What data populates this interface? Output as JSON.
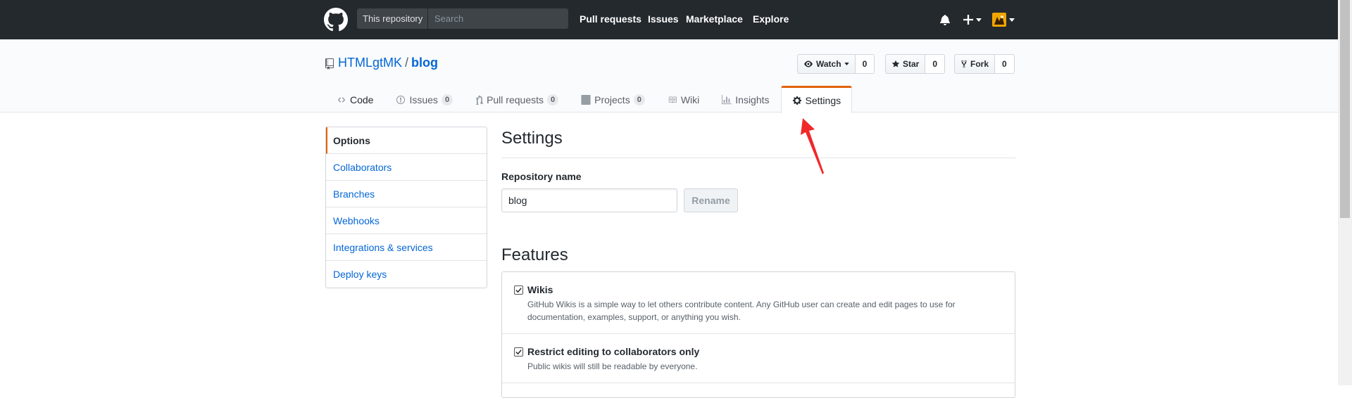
{
  "header": {
    "search_scope": "This repository",
    "search_placeholder": "Search",
    "nav": [
      "Pull requests",
      "Issues",
      "Marketplace",
      "Explore"
    ]
  },
  "repo": {
    "owner": "HTMLgtMK",
    "separator": "/",
    "name": "blog",
    "watch": {
      "label": "Watch",
      "count": "0"
    },
    "star": {
      "label": "Star",
      "count": "0"
    },
    "fork": {
      "label": "Fork",
      "count": "0"
    }
  },
  "reponav": {
    "code": "Code",
    "issues": "Issues",
    "issues_count": "0",
    "pulls": "Pull requests",
    "pulls_count": "0",
    "projects": "Projects",
    "projects_count": "0",
    "wiki": "Wiki",
    "insights": "Insights",
    "settings": "Settings"
  },
  "menu": [
    "Options",
    "Collaborators",
    "Branches",
    "Webhooks",
    "Integrations & services",
    "Deploy keys"
  ],
  "main": {
    "title": "Settings",
    "repo_name_label": "Repository name",
    "repo_name_value": "blog",
    "rename_label": "Rename",
    "features_title": "Features",
    "features": [
      {
        "title": "Wikis",
        "checked": true,
        "desc_line1": "GitHub Wikis is a simple way to let others contribute content. Any GitHub user can create and edit pages to use for",
        "desc_line2": "documentation, examples, support, or anything you wish."
      },
      {
        "title": "Restrict editing to collaborators only",
        "checked": true,
        "desc_line1": "Public wikis will still be readable by everyone."
      }
    ]
  },
  "colors": {
    "header_bg": "#24292e",
    "link": "#0366d6",
    "accent": "#e36209",
    "annotation": "#f0282a"
  }
}
